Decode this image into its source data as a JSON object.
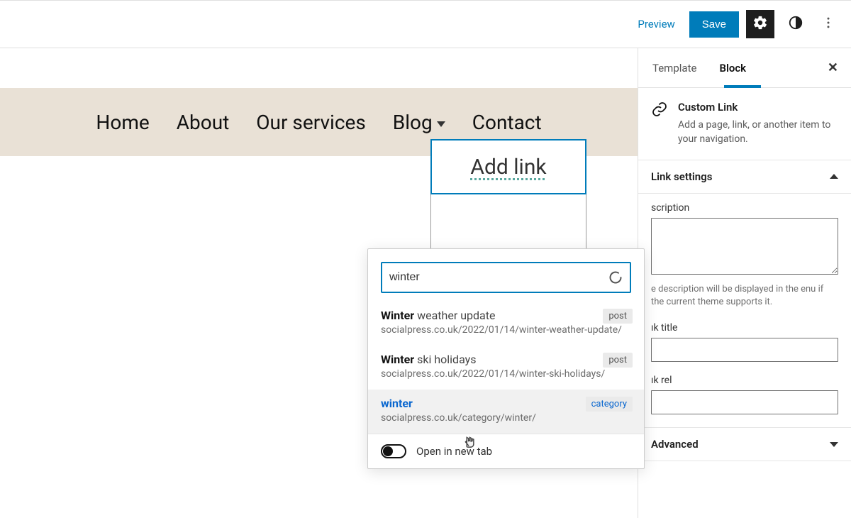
{
  "topbar": {
    "preview": "Preview",
    "save": "Save"
  },
  "nav": {
    "items": [
      "Home",
      "About",
      "Our services",
      "Blog",
      "Contact"
    ],
    "add_link_label": "Add link"
  },
  "link_popover": {
    "search_value": "winter",
    "results": [
      {
        "match": "Winter",
        "rest": " weather update",
        "url": "socialpress.co.uk/2022/01/14/winter-weather-update/",
        "badge": "post",
        "hovered": false
      },
      {
        "match": "Winter",
        "rest": " ski holidays",
        "url": "socialpress.co.uk/2022/01/14/winter-ski-holidays/",
        "badge": "post",
        "hovered": false
      },
      {
        "title_plain": "winter",
        "url": "socialpress.co.uk/category/winter/",
        "badge": "category",
        "hovered": true
      }
    ],
    "open_new_tab": "Open in new tab"
  },
  "sidebar": {
    "tabs": {
      "template": "Template",
      "block": "Block"
    },
    "block": {
      "name": "Custom Link",
      "desc": "Add a page, link, or another item to your navigation."
    },
    "link_settings": {
      "title": "Link settings",
      "description_label": "scription",
      "description_help": "e description will be displayed in the enu if the current theme supports it.",
      "link_title_label": "ık title",
      "link_rel_label": "ık rel"
    },
    "advanced": {
      "title": "Advanced"
    }
  }
}
